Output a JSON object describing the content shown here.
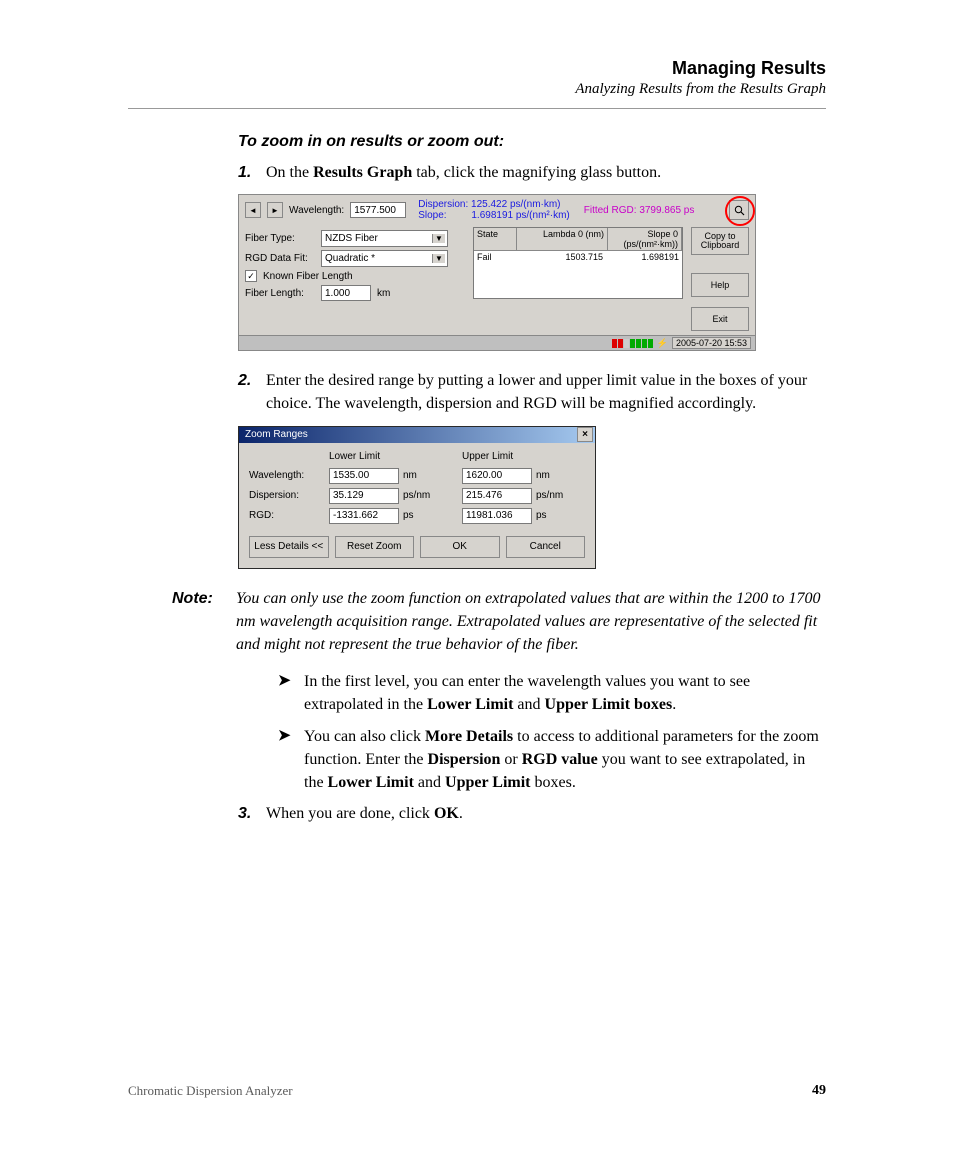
{
  "header": {
    "title": "Managing Results",
    "subtitle": "Analyzing Results from the Results Graph"
  },
  "task_heading": "To zoom in on results or zoom out:",
  "steps": {
    "s1": {
      "num": "1.",
      "pre": "On the ",
      "b1": "Results Graph",
      "post": " tab, click the magnifying glass button."
    },
    "s2": {
      "num": "2.",
      "text": "Enter the desired range by putting a lower and upper limit value in the boxes of your choice. The wavelength, dispersion and RGD will be magnified accordingly."
    },
    "s3": {
      "num": "3.",
      "pre": "When you are done, click ",
      "b1": "OK",
      "post": "."
    }
  },
  "note": {
    "label": "Note:",
    "text": "You can only use the zoom function on extrapolated values that are within the 1200 to 1700 nm wavelength acquisition range. Extrapolated values are representative of the selected fit and might not represent the true behavior of the fiber."
  },
  "bullets": {
    "b1": {
      "pre": "In the first level, you can enter the wavelength values you want to see extrapolated in the ",
      "b1": "Lower Limit",
      "mid": " and ",
      "b2": "Upper Limit boxes",
      "post": "."
    },
    "b2": {
      "pre": "You can also click ",
      "b1": "More Details",
      "mid1": " to access to additional parameters for the zoom function. Enter the ",
      "b2": "Dispersion",
      "mid2": " or ",
      "b3": "RGD value",
      "mid3": " you want to see extrapolated, in the ",
      "b4": "Lower Limit",
      "mid4": " and ",
      "b5": "Upper Limit",
      "post": " boxes."
    }
  },
  "footer": {
    "left": "Chromatic Dispersion Analyzer",
    "page": "49"
  },
  "shot1": {
    "nav_prev": "◄",
    "nav_next": "►",
    "wavelength_lbl": "Wavelength:",
    "wavelength_val": "1577.500",
    "dispersion_lbl": "Dispersion:",
    "dispersion_val": "125.422 ps/(nm·km)",
    "slope_lbl": "Slope:",
    "slope_val": "1.698191 ps/(nm²·km)",
    "fitted_lbl": "Fitted RGD:",
    "fitted_val": "3799.865 ps",
    "fiber_type_lbl": "Fiber Type:",
    "fiber_type_val": "NZDS Fiber",
    "rgd_fit_lbl": "RGD Data Fit:",
    "rgd_fit_val": "Quadratic *",
    "known_lbl": "Known Fiber Length",
    "fiber_len_lbl": "Fiber Length:",
    "fiber_len_val": "1.000",
    "fiber_len_unit": "km",
    "tbl": {
      "h1": "State",
      "h2": "Lambda 0 (nm)",
      "h3": "Slope 0 (ps/(nm²·km))",
      "r1c1": "Fail",
      "r1c2": "1503.715",
      "r1c3": "1.698191"
    },
    "side": {
      "copy": "Copy to Clipboard",
      "help": "Help",
      "exit": "Exit"
    },
    "status_time": "2005-07-20 15:53"
  },
  "shot2": {
    "title": "Zoom Ranges",
    "lower": "Lower Limit",
    "upper": "Upper Limit",
    "wl_lbl": "Wavelength:",
    "wl_lo": "1535.00",
    "wl_hi": "1620.00",
    "wl_unit": "nm",
    "d_lbl": "Dispersion:",
    "d_lo": "35.129",
    "d_hi": "215.476",
    "d_unit": "ps/nm",
    "r_lbl": "RGD:",
    "r_lo": "-1331.662",
    "r_hi": "11981.036",
    "r_unit": "ps",
    "btn_less": "Less Details <<",
    "btn_reset": "Reset Zoom",
    "btn_ok": "OK",
    "btn_cancel": "Cancel"
  }
}
